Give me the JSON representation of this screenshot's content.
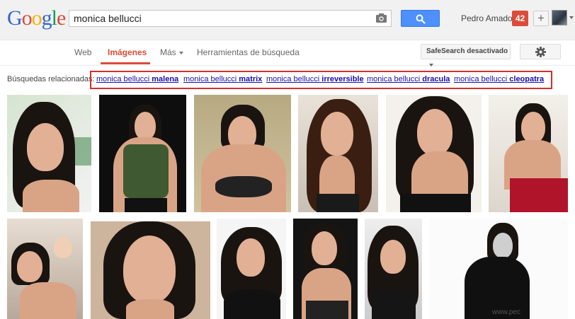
{
  "logo": {
    "letters": [
      "G",
      "o",
      "o",
      "g",
      "l",
      "e"
    ],
    "colors": [
      "#3366cc",
      "#dd4b39",
      "#f4b400",
      "#3366cc",
      "#109d58",
      "#dd4b39"
    ]
  },
  "search": {
    "value": "monica bellucci"
  },
  "header": {
    "user_name": "Pedro Amador",
    "notification_count": "42",
    "add_label": "+"
  },
  "nav": {
    "tabs": [
      {
        "label": "Web"
      },
      {
        "label": "Imágenes"
      },
      {
        "label": "Más"
      },
      {
        "label": "Herramientas de búsqueda"
      }
    ],
    "safesearch_label": "SafeSearch desactivado"
  },
  "related": {
    "label": "Búsquedas relacionadas:",
    "links": [
      {
        "prefix": "monica bellucci ",
        "bold": "malena"
      },
      {
        "prefix": "monica bellucci ",
        "bold": "matrix"
      },
      {
        "prefix": "monica bellucci ",
        "bold": "irreversible"
      },
      {
        "prefix": "monica bellucci ",
        "bold": "dracula"
      },
      {
        "prefix": "monica bellucci ",
        "bold": "cleopatra"
      }
    ]
  },
  "watermark": "www.pec",
  "colors": {
    "accent": "#dd4b39",
    "primary_blue": "#4d90fe",
    "link": "#1a0dab",
    "highlight_box": "#d32f2f"
  }
}
